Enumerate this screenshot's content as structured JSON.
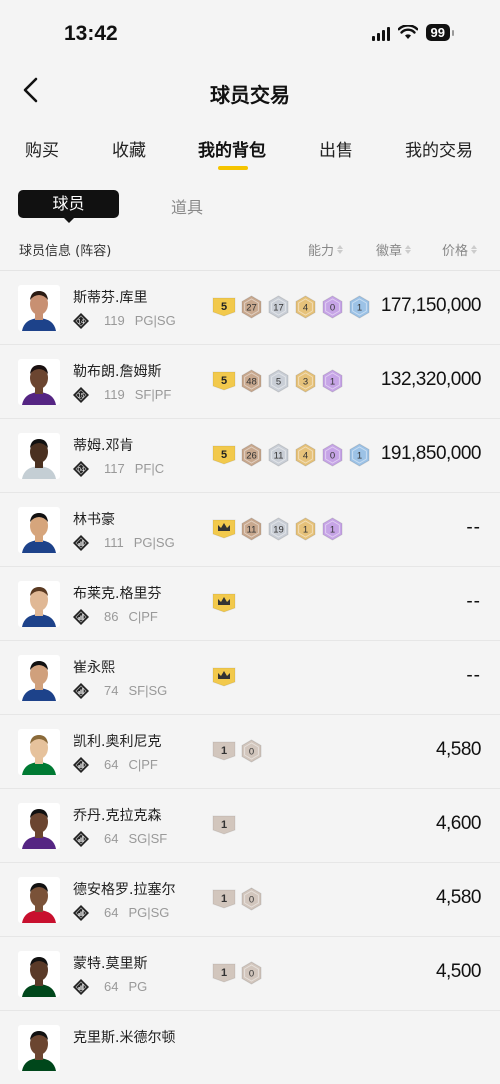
{
  "status": {
    "time": "13:42",
    "battery": "99"
  },
  "nav": {
    "title": "球员交易"
  },
  "main_tabs": [
    {
      "label": "购买"
    },
    {
      "label": "收藏"
    },
    {
      "label": "我的背包",
      "active": true
    },
    {
      "label": "出售"
    },
    {
      "label": "我的交易"
    }
  ],
  "sub_tabs": [
    {
      "label": "球员",
      "active": true
    },
    {
      "label": "道具"
    }
  ],
  "columns": {
    "info": "球员信息 (阵容)",
    "ability": "能力",
    "badge": "徽章",
    "price": "价格"
  },
  "players": [
    {
      "name": "斯蒂芬.库里",
      "tier": "14",
      "rating": "119",
      "position": "PG|SG",
      "badges": [
        "5",
        "27",
        "17",
        "4",
        "0",
        "1"
      ],
      "price": "177,150,000"
    },
    {
      "name": "勒布朗.詹姆斯",
      "tier": "15",
      "rating": "119",
      "position": "SF|PF",
      "badges": [
        "5",
        "48",
        "5",
        "3",
        "1"
      ],
      "price": "132,320,000"
    },
    {
      "name": "蒂姆.邓肯",
      "tier": "04",
      "rating": "117",
      "position": "PF|C",
      "badges": [
        "5",
        "26",
        "11",
        "4",
        "0",
        "1"
      ],
      "price": "191,850,000"
    },
    {
      "name": "林书豪",
      "tier": "",
      "rating": "111",
      "position": "PG|SG",
      "badges": [
        "crown",
        "11",
        "19",
        "1",
        "1"
      ],
      "price": "--"
    },
    {
      "name": "布莱克.格里芬",
      "tier": "",
      "rating": "86",
      "position": "C|PF",
      "badges": [
        "crown"
      ],
      "price": "--"
    },
    {
      "name": "崔永熙",
      "tier": "",
      "rating": "74",
      "position": "SF|SG",
      "badges": [
        "crown"
      ],
      "price": "--"
    },
    {
      "name": "凯利.奥利尼克",
      "tier": "",
      "rating": "64",
      "position": "C|PF",
      "badges": [
        "1",
        "0"
      ],
      "price": "4,580"
    },
    {
      "name": "乔丹.克拉克森",
      "tier": "",
      "rating": "64",
      "position": "SG|SF",
      "badges": [
        "1"
      ],
      "price": "4,600"
    },
    {
      "name": "德安格罗.拉塞尔",
      "tier": "",
      "rating": "64",
      "position": "PG|SG",
      "badges": [
        "1",
        "0"
      ],
      "price": "4,580"
    },
    {
      "name": "蒙特.莫里斯",
      "tier": "",
      "rating": "64",
      "position": "PG",
      "badges": [
        "1",
        "0"
      ],
      "price": "4,500"
    },
    {
      "name": "克里斯.米德尔顿",
      "tier": "",
      "rating": "",
      "position": "",
      "badges": [],
      "price": ""
    }
  ],
  "colors": {
    "accent": "#f5c400",
    "badge_gold": "#f2c94c",
    "badge_bronze": "#c8a88e",
    "badge_silver": "#c9ced6",
    "badge_amber": "#e6c27a",
    "badge_purple": "#c6a4e6",
    "badge_blue": "#9cc2e6",
    "badge_gray": "#d2c6bd"
  }
}
